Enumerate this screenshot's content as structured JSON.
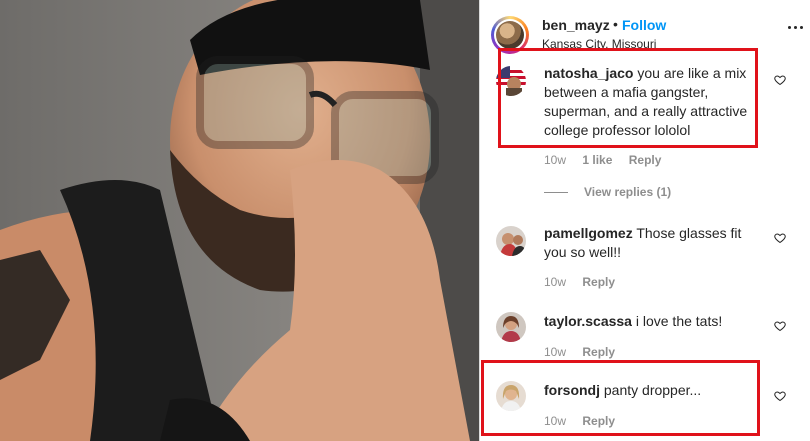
{
  "post": {
    "username": "ben_mayz",
    "separator": "•",
    "follow_label": "Follow",
    "location": "Kansas City, Missouri"
  },
  "comments": [
    {
      "username": "natosha_jaco",
      "text": "you are like a mix between a mafia gangster, superman, and a really attractive college professor lololol",
      "age": "10w",
      "likes": "1 like",
      "reply_label": "Reply",
      "view_replies": "View replies (1)"
    },
    {
      "username": "pamellgomez",
      "text": "Those glasses fit you so well!!",
      "age": "10w",
      "reply_label": "Reply"
    },
    {
      "username": "taylor.scassa",
      "text": "i love the tats!",
      "age": "10w",
      "reply_label": "Reply"
    },
    {
      "username": "forsondj",
      "text": "panty dropper...",
      "age": "10w",
      "reply_label": "Reply"
    }
  ],
  "colors": {
    "link_blue": "#0095f6",
    "highlight_red": "#e0121a",
    "meta_gray": "#8e8e8e"
  }
}
